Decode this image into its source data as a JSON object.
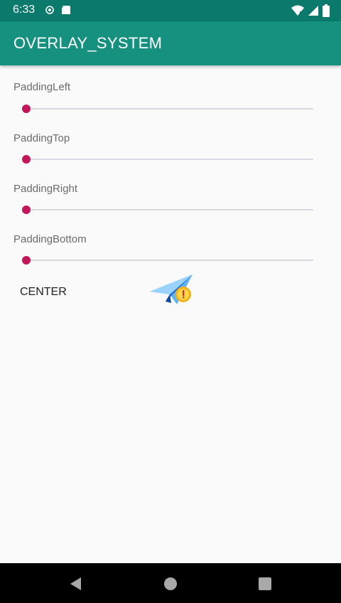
{
  "status_bar": {
    "time": "6:33",
    "left_icons": [
      "record-icon",
      "sd-card-icon"
    ],
    "right_icons": [
      "wifi-icon",
      "cell-signal-icon",
      "battery-icon"
    ]
  },
  "app_bar": {
    "title": "OVERLAY_SYSTEM",
    "color": "#16907f"
  },
  "settings": [
    {
      "label": "PaddingLeft",
      "value": 0
    },
    {
      "label": "PaddingTop",
      "value": 0
    },
    {
      "label": "PaddingRight",
      "value": 0
    },
    {
      "label": "PaddingBottom",
      "value": 0
    }
  ],
  "slider_color": "#c2185b",
  "center_button": {
    "label": "CENTER"
  },
  "overlay": {
    "icon": "paper-plane-clock-icon"
  },
  "nav_bar": {
    "buttons": [
      "back-icon",
      "home-icon",
      "recents-icon"
    ]
  }
}
